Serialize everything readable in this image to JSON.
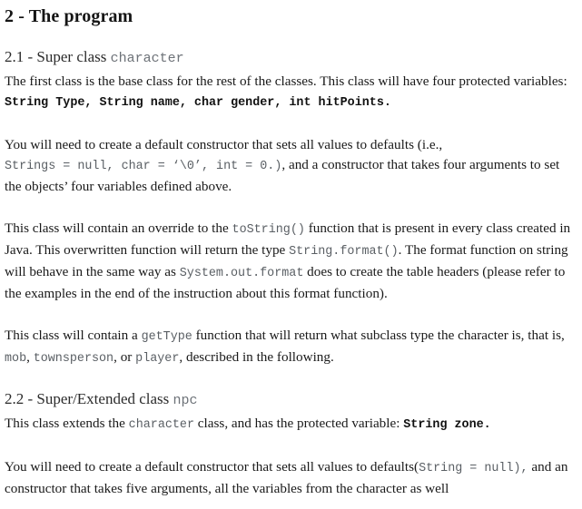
{
  "document": {
    "title": "2 - The program",
    "sections": [
      {
        "number": "2.1 - Super class ",
        "class_name": "character",
        "paragraphs": [
          {
            "id": "p-first-class",
            "runs": [
              {
                "type": "text",
                "value": "The first class is the base class for the rest of the classes. This class will have four protected variables: "
              },
              {
                "type": "code-bold",
                "value": "String Type, String name, char gender, int hitPoints."
              }
            ]
          },
          {
            "id": "p-default-constructor",
            "runs": [
              {
                "type": "text",
                "value": "You will need to create a default constructor that sets all values to defaults (i.e., "
              },
              {
                "type": "code",
                "value": "Strings = null, char = ‘\\0’, int = 0.)"
              },
              {
                "type": "text",
                "value": ", and a constructor that takes four arguments to set the objects’ four variables defined above."
              }
            ]
          },
          {
            "id": "p-tostring",
            "runs": [
              {
                "type": "text",
                "value": "This class will contain an override to the "
              },
              {
                "type": "code",
                "value": "toString()"
              },
              {
                "type": "text",
                "value": " function that is present in every class created in Java. This overwritten function will return the type "
              },
              {
                "type": "code",
                "value": "String.format()"
              },
              {
                "type": "text",
                "value": ". The format function on string will behave in the same way as "
              },
              {
                "type": "code",
                "value": "System.out.format"
              },
              {
                "type": "text",
                "value": " does to create the table headers (please refer to the examples in the end of the instruction about this format function)."
              }
            ]
          },
          {
            "id": "p-gettype",
            "runs": [
              {
                "type": "text",
                "value": "This class will contain a "
              },
              {
                "type": "code",
                "value": "getType"
              },
              {
                "type": "text",
                "value": "  function that will return what subclass type the character is, that is, "
              },
              {
                "type": "code",
                "value": "mob"
              },
              {
                "type": "text",
                "value": ", "
              },
              {
                "type": "code",
                "value": "townsperson"
              },
              {
                "type": "text",
                "value": ", or "
              },
              {
                "type": "code",
                "value": "player"
              },
              {
                "type": "text",
                "value": ", described in the following."
              }
            ]
          }
        ]
      },
      {
        "number": "2.2 - Super/Extended class ",
        "class_name": "npc",
        "paragraphs": [
          {
            "id": "p-npc-extends",
            "runs": [
              {
                "type": "text",
                "value": "This class extends the "
              },
              {
                "type": "code",
                "value": "character"
              },
              {
                "type": "text",
                "value": "  class, and has the protected variable: "
              },
              {
                "type": "code-bold",
                "value": "String zone."
              }
            ]
          },
          {
            "id": "p-npc-constructor",
            "runs": [
              {
                "type": "text",
                "value": "You will need to create a default constructor that sets all values to defaults("
              },
              {
                "type": "code",
                "value": "String = null),"
              },
              {
                "type": "text",
                "value": " and an constructor that takes five arguments, all the variables from the character as well"
              }
            ]
          }
        ]
      }
    ]
  },
  "style": {
    "background_color": "#ffffff",
    "body_text_color": "#191919",
    "heading_color": "#151515",
    "code_color": "#4e5256"
  }
}
